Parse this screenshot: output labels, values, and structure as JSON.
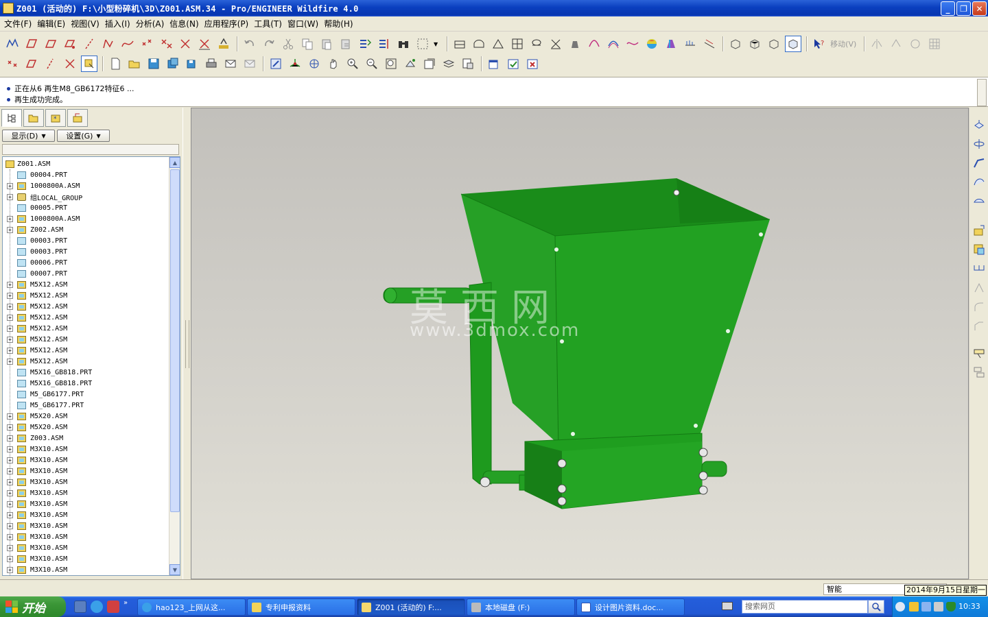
{
  "window": {
    "title": "Z001 (活动的) F:\\小型粉碎机\\3D\\Z001.ASM.34 - Pro/ENGINEER Wildfire 4.0",
    "minimize_icon": "minimize-icon",
    "restore_icon": "restore-icon",
    "close_icon": "close-icon"
  },
  "menu": {
    "items": [
      {
        "label": "文件(F)"
      },
      {
        "label": "编辑(E)"
      },
      {
        "label": "视图(V)"
      },
      {
        "label": "插入(I)"
      },
      {
        "label": "分析(A)"
      },
      {
        "label": "信息(N)"
      },
      {
        "label": "应用程序(P)"
      },
      {
        "label": "工具(T)"
      },
      {
        "label": "窗口(W)"
      },
      {
        "label": "帮助(H)"
      }
    ]
  },
  "toolbar": {
    "move_label": "移动(V)"
  },
  "messages": [
    {
      "text": "正在从6 再生M8_GB6172特征6 ..."
    },
    {
      "text": "再生成功完成。"
    }
  ],
  "panel": {
    "display_button": "显示(D)",
    "settings_button": "设置(G)",
    "tree": [
      {
        "label": "Z001.ASM",
        "type": "root"
      },
      {
        "label": "00004.PRT",
        "type": "prt",
        "expand": false
      },
      {
        "label": "1000800A.ASM",
        "type": "asm",
        "expand": true
      },
      {
        "label": "组LOCAL_GROUP",
        "type": "grp",
        "expand": true
      },
      {
        "label": "00005.PRT",
        "type": "prt",
        "expand": false
      },
      {
        "label": "1000800A.ASM",
        "type": "asm",
        "expand": true
      },
      {
        "label": "Z002.ASM",
        "type": "asm",
        "expand": true
      },
      {
        "label": "00003.PRT",
        "type": "prt",
        "expand": false
      },
      {
        "label": "00003.PRT",
        "type": "prt",
        "expand": false
      },
      {
        "label": "00006.PRT",
        "type": "prt",
        "expand": false
      },
      {
        "label": "00007.PRT",
        "type": "prt",
        "expand": false
      },
      {
        "label": "M5X12.ASM",
        "type": "asm",
        "expand": true
      },
      {
        "label": "M5X12.ASM",
        "type": "asm",
        "expand": true
      },
      {
        "label": "M5X12.ASM",
        "type": "asm",
        "expand": true
      },
      {
        "label": "M5X12.ASM",
        "type": "asm",
        "expand": true
      },
      {
        "label": "M5X12.ASM",
        "type": "asm",
        "expand": true
      },
      {
        "label": "M5X12.ASM",
        "type": "asm",
        "expand": true
      },
      {
        "label": "M5X12.ASM",
        "type": "asm",
        "expand": true
      },
      {
        "label": "M5X12.ASM",
        "type": "asm",
        "expand": true
      },
      {
        "label": "M5X16_GB818.PRT",
        "type": "prt",
        "expand": false
      },
      {
        "label": "M5X16_GB818.PRT",
        "type": "prt",
        "expand": false
      },
      {
        "label": "M5_GB6177.PRT",
        "type": "prt",
        "expand": false
      },
      {
        "label": "M5_GB6177.PRT",
        "type": "prt",
        "expand": false
      },
      {
        "label": "M5X20.ASM",
        "type": "asm",
        "expand": true
      },
      {
        "label": "M5X20.ASM",
        "type": "asm",
        "expand": true
      },
      {
        "label": "Z003.ASM",
        "type": "asm",
        "expand": true
      },
      {
        "label": "M3X10.ASM",
        "type": "asm",
        "expand": true
      },
      {
        "label": "M3X10.ASM",
        "type": "asm",
        "expand": true
      },
      {
        "label": "M3X10.ASM",
        "type": "asm",
        "expand": true
      },
      {
        "label": "M3X10.ASM",
        "type": "asm",
        "expand": true
      },
      {
        "label": "M3X10.ASM",
        "type": "asm",
        "expand": true
      },
      {
        "label": "M3X10.ASM",
        "type": "asm",
        "expand": true
      },
      {
        "label": "M3X10.ASM",
        "type": "asm",
        "expand": true
      },
      {
        "label": "M3X10.ASM",
        "type": "asm",
        "expand": true
      },
      {
        "label": "M3X10.ASM",
        "type": "asm",
        "expand": true
      },
      {
        "label": "M3X10.ASM",
        "type": "asm",
        "expand": true
      },
      {
        "label": "M3X10.ASM",
        "type": "asm",
        "expand": true
      },
      {
        "label": "M3X10.ASM",
        "type": "asm",
        "expand": true
      },
      {
        "label": "M3X10.ASM",
        "type": "asm",
        "expand": true
      }
    ]
  },
  "viewport": {
    "model_color": "#1fa51f",
    "model_dark": "#138a13",
    "watermark": "莫西网",
    "watermark_url": "www.3dmox.com"
  },
  "status": {
    "filter": "智能",
    "date_tooltip": "2014年9月15日星期一"
  },
  "taskbar": {
    "start_label": "开始",
    "tasks": [
      {
        "label": "hao123_上网从这...",
        "active": false
      },
      {
        "label": "专利申报资料",
        "active": false
      },
      {
        "label": "Z001 (活动的) F:...",
        "active": true
      },
      {
        "label": "本地磁盘 (F:)",
        "active": false
      },
      {
        "label": "设计图片资料.doc...",
        "active": false
      }
    ],
    "search_placeholder": "搜索网页",
    "clock": "10:33"
  }
}
